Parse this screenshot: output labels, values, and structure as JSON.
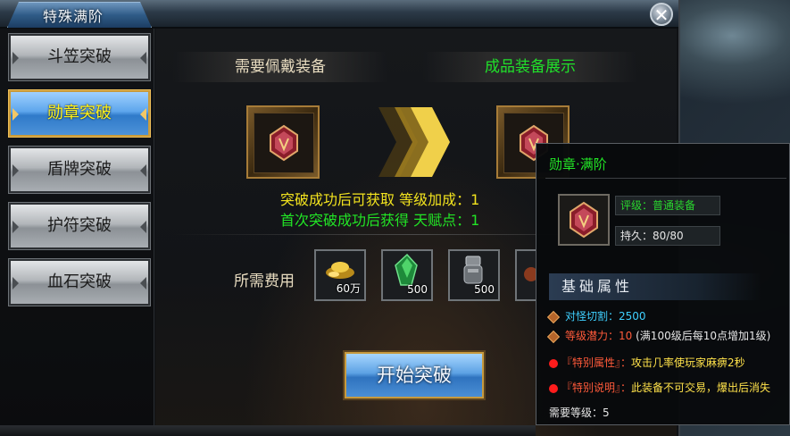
{
  "window": {
    "title": "特殊满阶",
    "close_symbol": "✕"
  },
  "sidebar": {
    "items": [
      {
        "label": "斗笠突破",
        "active": false
      },
      {
        "label": "勋章突破",
        "active": true
      },
      {
        "label": "盾牌突破",
        "active": false
      },
      {
        "label": "护符突破",
        "active": false
      },
      {
        "label": "血石突破",
        "active": false
      }
    ]
  },
  "main": {
    "required_header": "需要佩戴装备",
    "result_header": "成品装备展示",
    "gain_line": "突破成功后可获取 等级加成：1",
    "first_line": "首次突破成功后获得 天赋点：1",
    "cost_label": "所需费用",
    "costs": [
      {
        "icon": "gold-ingot-icon",
        "amount": "60万"
      },
      {
        "icon": "green-gem-icon",
        "amount": "500"
      },
      {
        "icon": "gauntlet-icon",
        "amount": "500"
      }
    ],
    "start_button": "开始突破"
  },
  "tooltip": {
    "title": "勋章·满阶",
    "grade": "评级：普通装备",
    "durability": "持久：80/80",
    "section": "基础属性",
    "attr1_label": "对怪切割：",
    "attr1_value": "2500",
    "attr2_label": "等级潜力：",
    "attr2_value": "10",
    "attr2_note": "(满100级后每10点增加1级)",
    "special_attr_label": "『特别属性』：",
    "special_attr_text": "攻击几率使玩家麻痹2秒",
    "special_note_label": "『特别说明』：",
    "special_note_text": "此装备不可交易，爆出后消失",
    "required_level": "需要等级：5"
  },
  "colors": {
    "accent_green": "#22e426",
    "accent_yellow": "#f2e31e",
    "active_blue": "#5ea6ec",
    "gold_border": "#c79a3e"
  }
}
